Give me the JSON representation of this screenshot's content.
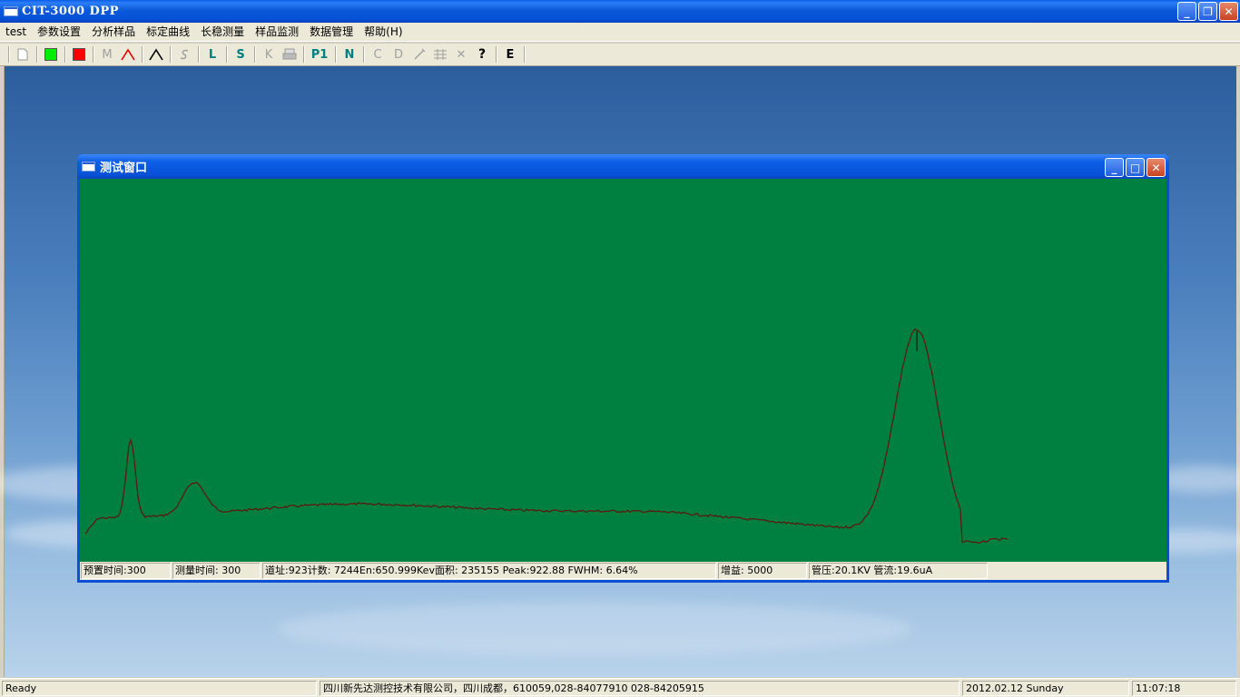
{
  "window": {
    "title": "CIT-3000 DPP"
  },
  "menu": [
    "test",
    "参数设置",
    "分析样品",
    "标定曲线",
    "长稳测量",
    "样品监测",
    "数据管理",
    "帮助(H)"
  ],
  "toolbar": {
    "new": "",
    "m_label": "M",
    "l_label": "L",
    "s_label": "S",
    "k_label": "K",
    "p1_label": "P1",
    "n_label": "N",
    "c_label": "C",
    "d_label": "D",
    "x_label": "✕",
    "help_label": "?",
    "e_label": "E",
    "colors": {
      "green": "#00ee00",
      "red": "#ff0000",
      "teal": "#008080"
    }
  },
  "child_window": {
    "title": "测试窗口",
    "plot_bg": "#008040",
    "trace_color": "#5a1a10",
    "status": {
      "preset_time": "预置时间:300",
      "measure_time": "测量时间:  300",
      "peak_info": "道址:923计数: 7244En:650.999Kev面积: 235155 Peak:922.88 FWHM:   6.64%",
      "gain": "增益: 5000",
      "tube": "管压:20.1KV 管流:19.6uA"
    }
  },
  "statusbar": {
    "ready": "Ready",
    "company": "四川新先达测控技术有限公司，四川成都，610059,028-84077910 028-84205915",
    "date": "2012.02.12 Sunday",
    "time": "11:07:18"
  }
}
